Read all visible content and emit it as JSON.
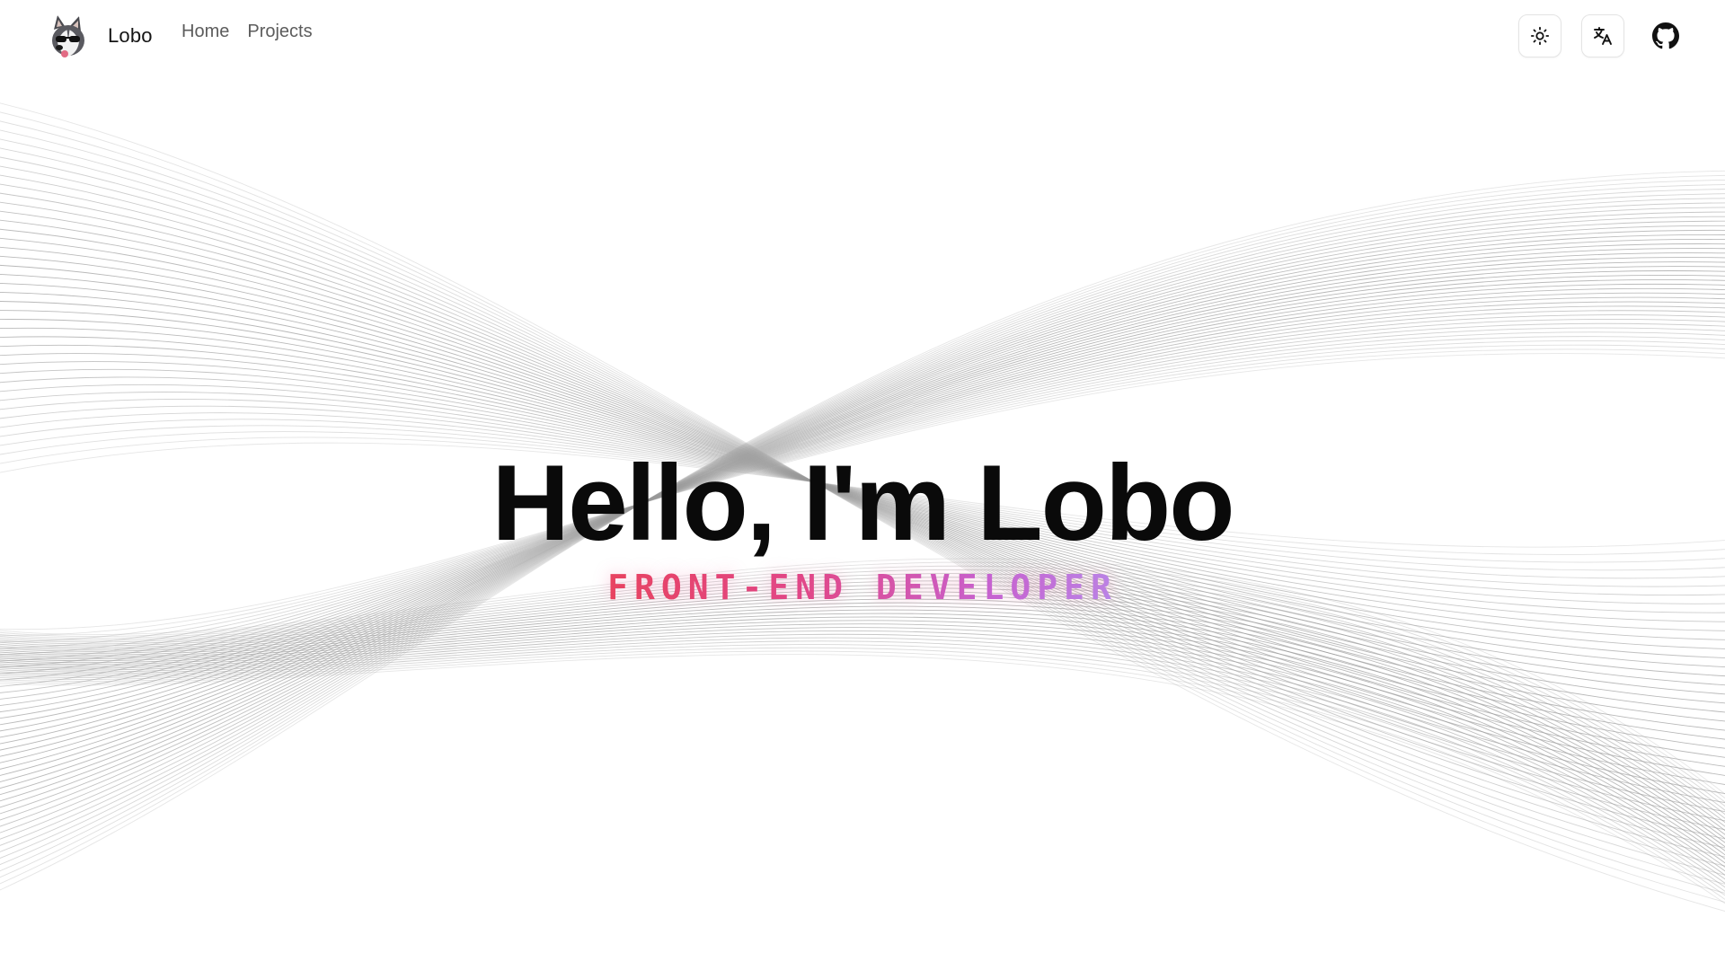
{
  "header": {
    "brand_name": "Lobo",
    "nav": [
      {
        "label": "Home"
      },
      {
        "label": "Projects"
      }
    ],
    "actions": {
      "theme_icon": "sun-icon",
      "language_icon": "translate-icon",
      "github_icon": "github-icon"
    }
  },
  "hero": {
    "title": "Hello, I'm Lobo",
    "subtitle": "FRONT-END DEVELOPER"
  },
  "colors": {
    "title": "#0a0a0a",
    "subtitle_gradient": [
      "#e8425c",
      "#e0478a",
      "#c464d6",
      "#b58af0"
    ],
    "wave_lines": "#9a9a9a"
  }
}
